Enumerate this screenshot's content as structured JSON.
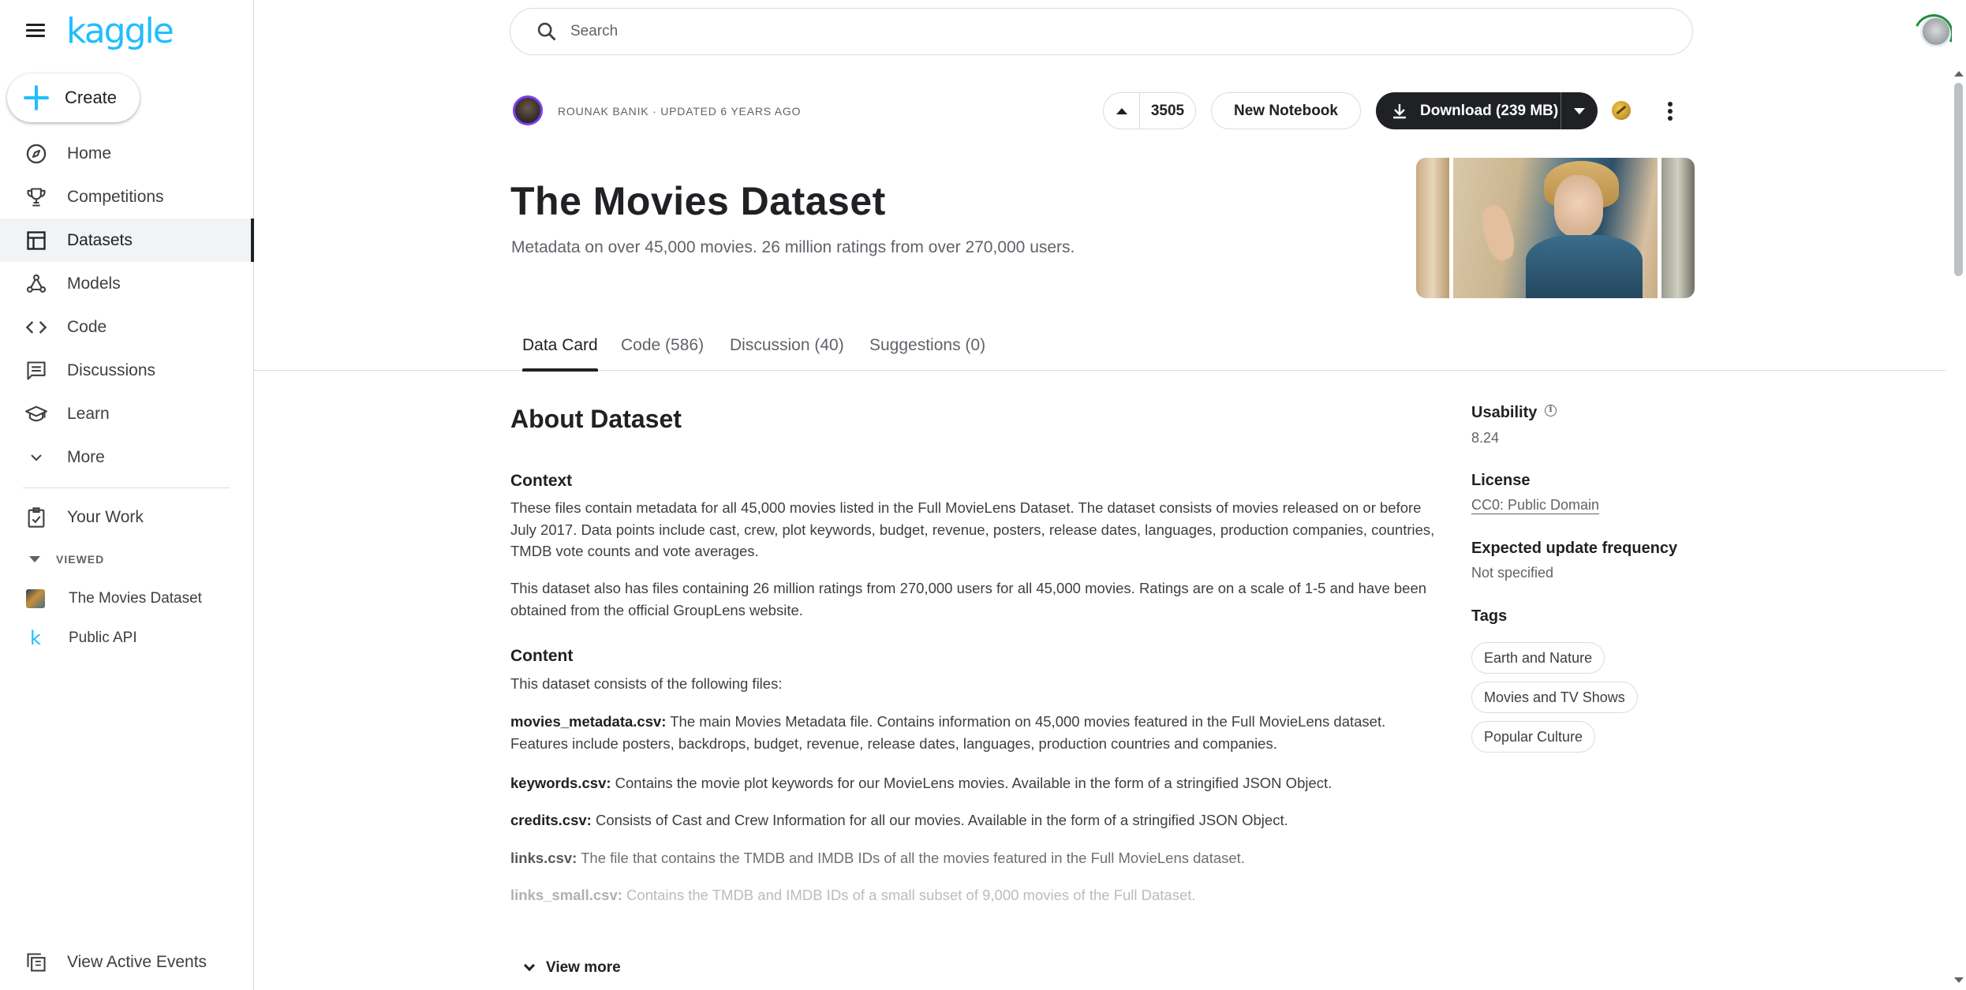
{
  "sidebar": {
    "logo": "kaggle",
    "create_label": "Create",
    "nav": [
      {
        "label": "Home",
        "icon": "compass-icon"
      },
      {
        "label": "Competitions",
        "icon": "trophy-icon"
      },
      {
        "label": "Datasets",
        "icon": "table-icon",
        "active": true
      },
      {
        "label": "Models",
        "icon": "models-icon"
      },
      {
        "label": "Code",
        "icon": "code-icon"
      },
      {
        "label": "Discussions",
        "icon": "discussion-icon"
      },
      {
        "label": "Learn",
        "icon": "school-icon"
      },
      {
        "label": "More",
        "icon": "chevron-down-icon"
      }
    ],
    "your_work": "Your Work",
    "viewed_header": "VIEWED",
    "recent": [
      {
        "label": "The Movies Dataset"
      },
      {
        "label": "Public API"
      }
    ],
    "events_label": "View Active Events"
  },
  "search": {
    "placeholder": "Search"
  },
  "header": {
    "owner": "ROUNAK BANIK",
    "updated": "UPDATED 6 YEARS AGO",
    "upvotes": "3505",
    "new_notebook": "New Notebook",
    "download": "Download (239 MB)",
    "title": "The Movies Dataset",
    "subtitle": "Metadata on over 45,000 movies. 26 million ratings from over 270,000 users."
  },
  "tabs": [
    {
      "label": "Data Card",
      "active": true
    },
    {
      "label": "Code (586)"
    },
    {
      "label": "Discussion (40)"
    },
    {
      "label": "Suggestions (0)"
    }
  ],
  "about": {
    "heading": "About Dataset",
    "context_heading": "Context",
    "context_p1": "These files contain metadata for all 45,000 movies listed in the Full MovieLens Dataset. The dataset consists of movies released on or before July 2017. Data points include cast, crew, plot keywords, budget, revenue, posters, release dates, languages, production companies, countries, TMDB vote counts and vote averages.",
    "context_p2": "This dataset also has files containing 26 million ratings from 270,000 users for all 45,000 movies. Ratings are on a scale of 1-5 and have been obtained from the official GroupLens website.",
    "content_heading": "Content",
    "content_intro": "This dataset consists of the following files:",
    "files": [
      {
        "name": "movies_metadata.csv:",
        "desc": " The main Movies Metadata file. Contains information on 45,000 movies featured in the Full MovieLens dataset. Features include posters, backdrops, budget, revenue, release dates, languages, production countries and companies."
      },
      {
        "name": "keywords.csv:",
        "desc": " Contains the movie plot keywords for our MovieLens movies. Available in the form of a stringified JSON Object."
      },
      {
        "name": "credits.csv:",
        "desc": " Consists of Cast and Crew Information for all our movies. Available in the form of a stringified JSON Object."
      },
      {
        "name": "links.csv:",
        "desc": " The file that contains the TMDB and IMDB IDs of all the movies featured in the Full MovieLens dataset."
      },
      {
        "name": "links_small.csv:",
        "desc": " Contains the TMDB and IMDB IDs of a small subset of 9,000 movies of the Full Dataset."
      }
    ],
    "view_more": "View more"
  },
  "meta": {
    "usability_label": "Usability",
    "usability_value": "8.24",
    "license_label": "License",
    "license_value": "CC0: Public Domain",
    "frequency_label": "Expected update frequency",
    "frequency_value": "Not specified",
    "tags_label": "Tags",
    "tags": [
      "Earth and Nature",
      "Movies and TV Shows",
      "Popular Culture"
    ]
  },
  "colors": {
    "brand": "#20beff",
    "primary_dark": "#202124",
    "muted_text": "#5f6368",
    "border": "#dadce0"
  }
}
